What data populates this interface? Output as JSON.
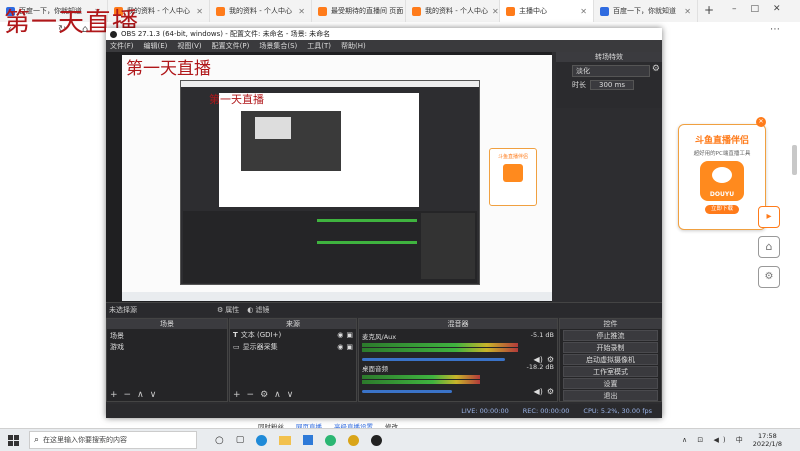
{
  "overlay_title": "第一天直播",
  "browser": {
    "tabs": [
      {
        "label": "百度一下，你就知道",
        "active": false,
        "fav_color": "#2f6be0"
      },
      {
        "label": "我的资料 - 个人中心",
        "active": false,
        "fav_color": "#ff7b1a"
      },
      {
        "label": "我的资料 - 个人中心",
        "active": false,
        "fav_color": "#ff7b1a"
      },
      {
        "label": "最受期待的直播间 页面",
        "active": false,
        "fav_color": "#ff7b1a"
      },
      {
        "label": "我的资料 - 个人中心",
        "active": false,
        "fav_color": "#ff7b1a"
      },
      {
        "label": "主播中心",
        "active": true,
        "fav_color": "#ff7b1a"
      },
      {
        "label": "百度一下，你就知道",
        "active": false,
        "fav_color": "#2f6be0"
      }
    ],
    "new_tab": "+",
    "win_controls": [
      "–",
      "□",
      "✕"
    ]
  },
  "obs": {
    "title": "OBS 27.1.3 (64-bit, windows) - 配置文件: 未命名 - 场景: 未命名",
    "menu": [
      "文件(F)",
      "编辑(E)",
      "视图(V)",
      "配置文件(P)",
      "场景集合(S)",
      "工具(T)",
      "帮助(H)"
    ],
    "transition": {
      "title": "转场特效",
      "selected": "淡化",
      "duration_label": "时长",
      "duration_value": "300 ms"
    },
    "no_source_selected": "未选择源",
    "properties_label": "属性",
    "filters_label": "滤镜",
    "scenes": {
      "title": "场景",
      "items": [
        "场景",
        "游戏"
      ]
    },
    "sources": {
      "title": "来源",
      "items": [
        "文本 (GDI+)",
        "显示器采集"
      ]
    },
    "mixer": {
      "title": "混音器",
      "channels": [
        {
          "name": "麦克风/Aux",
          "level": "-5.1 dB",
          "meter": 0.82,
          "volume": 0.95
        },
        {
          "name": "桌面音频",
          "level": "-18.2 dB",
          "meter": 0.62,
          "volume": 0.6
        }
      ]
    },
    "controls": {
      "title": "控件",
      "buttons": [
        "停止推流",
        "开始录制",
        "启动虚拟摄像机",
        "工作室模式",
        "设置",
        "退出"
      ]
    },
    "status": {
      "live": "LIVE: 00:00:00",
      "rec": "REC: 00:00:00",
      "cpu": "CPU: 5.2%, 30.00 fps"
    }
  },
  "page_bottom": {
    "links": [
      "同时粉丝",
      "网页直播",
      "高级直播设置",
      "修改"
    ]
  },
  "ad": {
    "title": "斗鱼直播伴侣",
    "subtitle": "超好用的PC端直播工具",
    "logo_text": "DOUYU",
    "button": "立即下载",
    "close": "✕"
  },
  "taskbar": {
    "search_placeholder": "在这里输入你要搜索的内容",
    "time": "17:58",
    "date": "2022/1/8"
  },
  "colors": {
    "accent": "#ff7b1a",
    "obs_bg": "#2d2d30",
    "overlay_red": "#b0171a"
  }
}
